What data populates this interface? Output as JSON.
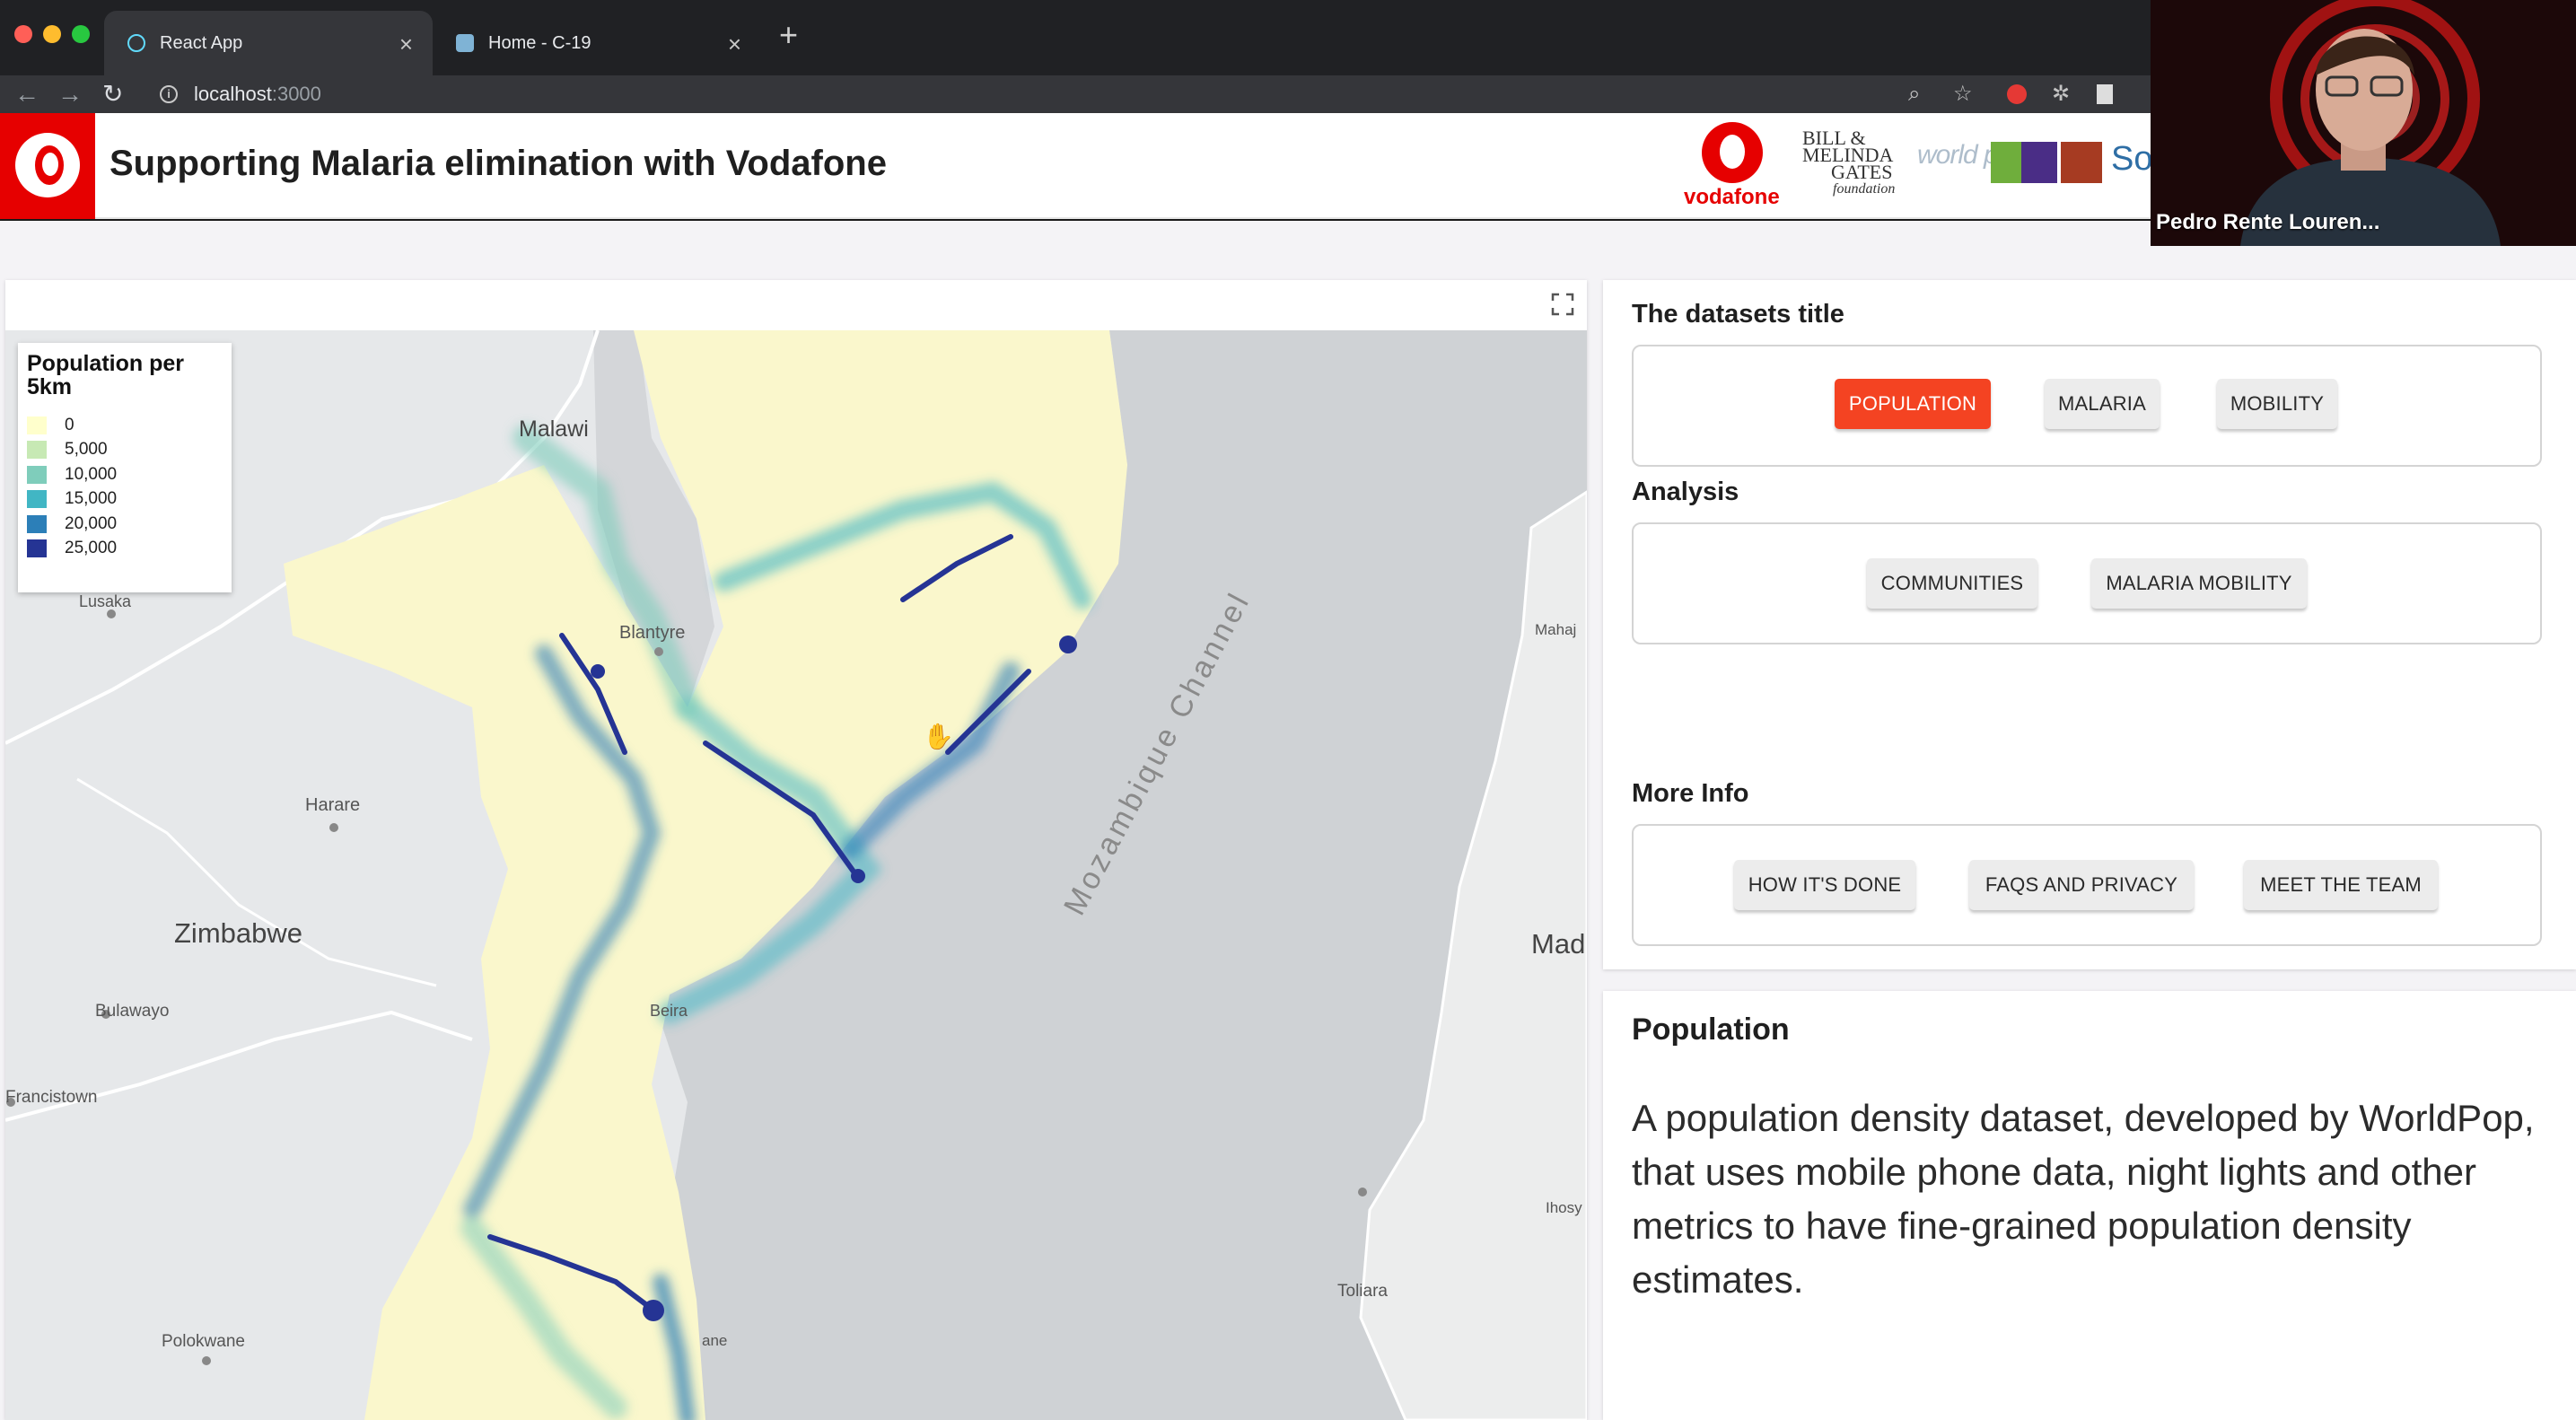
{
  "browser": {
    "tabs": [
      {
        "title": "React App",
        "active": true
      },
      {
        "title": "Home - C-19",
        "active": false
      }
    ],
    "url": {
      "host": "localhost",
      "port": ":3000"
    }
  },
  "header": {
    "title": "Supporting Malaria elimination with Vodafone",
    "partners": {
      "vodafone": "vodafone",
      "gates": [
        "BILL &",
        "MELINDA",
        "GATES"
      ],
      "gates_foundation": "foundation",
      "worldpop": "world pop",
      "sou": "Sou"
    }
  },
  "map": {
    "legend": {
      "title": "Population per 5km",
      "items": [
        {
          "label": "0",
          "color": "#ffffcc"
        },
        {
          "label": "5,000",
          "color": "#c7e9b4"
        },
        {
          "label": "10,000",
          "color": "#7fcdbb"
        },
        {
          "label": "15,000",
          "color": "#41b6c4"
        },
        {
          "label": "20,000",
          "color": "#2c7fb8"
        },
        {
          "label": "25,000",
          "color": "#253494"
        }
      ]
    },
    "labels": {
      "malawi": "Malawi",
      "lusaka": "Lusaka",
      "blantyre": "Blantyre",
      "harare": "Harare",
      "zimbabwe": "Zimbabwe",
      "bulawayo": "Bulawayo",
      "francistown": "Francistown",
      "beira": "Beira",
      "mozambique_channel": "Mozambique Channel",
      "mad": "Mad",
      "mahaj": "Mahaj",
      "ihosy": "Ihosy",
      "toliara": "Toliara",
      "polokwane": "Polokwane",
      "xai": "ane"
    }
  },
  "panel": {
    "datasets_title": "The datasets title",
    "datasets_buttons": [
      "POPULATION",
      "MALARIA",
      "MOBILITY"
    ],
    "analysis_title": "Analysis",
    "analysis_buttons": [
      "COMMUNITIES",
      "MALARIA MOBILITY"
    ],
    "more_info_title": "More Info",
    "more_info_buttons": [
      "HOW IT'S DONE",
      "FAQS AND PRIVACY",
      "MEET THE TEAM"
    ]
  },
  "info": {
    "title": "Population",
    "text": "A population density dataset, developed by WorldPop, that uses mobile phone data, night lights and other metrics to have fine-grained population density estimates."
  },
  "video": {
    "participant_name": "Pedro Rente Louren..."
  },
  "colors": {
    "vodafone_red": "#e60000",
    "active_button": "#f44322"
  }
}
